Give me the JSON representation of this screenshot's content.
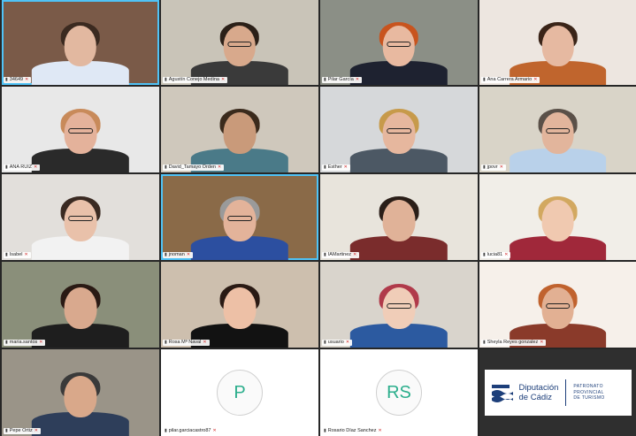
{
  "meeting": {
    "participants": [
      {
        "name": "34649",
        "bg": "#7a5a48",
        "skin": "#e2b8a0",
        "hair": "#3b2a20",
        "shirt": "#dfe8f5",
        "glasses": false
      },
      {
        "name": "Agustín Conejo Medina",
        "bg": "#c9c4b8",
        "skin": "#d8a98c",
        "hair": "#2b2018",
        "shirt": "#3a3a3a",
        "glasses": true
      },
      {
        "name": "Pilar García",
        "bg": "#8b8f86",
        "skin": "#e8b9a0",
        "hair": "#c8541e",
        "shirt": "#1e2230",
        "glasses": true
      },
      {
        "name": "Ana Carrera Armario",
        "bg": "#ede6e0",
        "skin": "#e6b9a1",
        "hair": "#3a2418",
        "shirt": "#c0652d",
        "glasses": false
      },
      {
        "name": "ANA RUIZ",
        "bg": "#e8e8e8",
        "skin": "#e4b29b",
        "hair": "#c88a5a",
        "shirt": "#2a2a2a",
        "glasses": true
      },
      {
        "name": "David_Tamayo Orden",
        "bg": "#cfc8bc",
        "skin": "#c99a7a",
        "hair": "#3a2a1c",
        "shirt": "#4a7a88",
        "glasses": false
      },
      {
        "name": "Esther",
        "bg": "#d6d8da",
        "skin": "#e6b79e",
        "hair": "#c79a4a",
        "shirt": "#4c5864",
        "glasses": true
      },
      {
        "name": "jpovr",
        "bg": "#d9d4c8",
        "skin": "#e2b59c",
        "hair": "#5a5048",
        "shirt": "#b9d1ea",
        "glasses": true
      },
      {
        "name": "Isabel",
        "bg": "#e2dfdb",
        "skin": "#e9c1aa",
        "hair": "#3a2a22",
        "shirt": "#f2f2f2",
        "glasses": true
      },
      {
        "name": "jnoman",
        "bg": "#8a6a48",
        "skin": "#e3b39a",
        "hair": "#9a9a9a",
        "shirt": "#2c4fa0",
        "glasses": true
      },
      {
        "name": "IAMartinez",
        "bg": "#e8e4dc",
        "skin": "#e0b298",
        "hair": "#2a1e18",
        "shirt": "#7a2c2c",
        "glasses": false
      },
      {
        "name": "lucia81",
        "bg": "#f1eee8",
        "skin": "#f0c9b0",
        "hair": "#d2a860",
        "shirt": "#a0283a",
        "glasses": false
      },
      {
        "name": "maria.santos",
        "bg": "#8a8f7a",
        "skin": "#d9a98e",
        "hair": "#2a1a14",
        "shirt": "#1e1e1e",
        "glasses": false
      },
      {
        "name": "Rosa Mª Naval",
        "bg": "#cdbfae",
        "skin": "#edc0a6",
        "hair": "#2a1a14",
        "shirt": "#121212",
        "glasses": false
      },
      {
        "name": "usuario",
        "bg": "#d9d4cc",
        "skin": "#f0cdb8",
        "hair": "#b03a4a",
        "shirt": "#2c5aa0",
        "glasses": true
      },
      {
        "name": "Sheyla Reyes gonzalez",
        "bg": "#f6f0ea",
        "skin": "#e2b093",
        "hair": "#c0622e",
        "shirt": "#8a3a2a",
        "glasses": true
      },
      {
        "name": "Pepe Ortiz",
        "bg": "#9a9488",
        "skin": "#d9a88a",
        "hair": "#3a3a3a",
        "shirt": "#2e3e5a",
        "glasses": false
      }
    ],
    "avatars": [
      {
        "initials": "P",
        "name": "pilar.garciacastro87"
      },
      {
        "initials": "RS",
        "name": "Rosario Díaz Sanchez"
      }
    ],
    "logo": {
      "line1": "Diputación",
      "line2": "de Cádiz",
      "sub1": "PATRONATO",
      "sub2": "PROVINCIAL",
      "sub3": "DE TURISMO"
    }
  }
}
